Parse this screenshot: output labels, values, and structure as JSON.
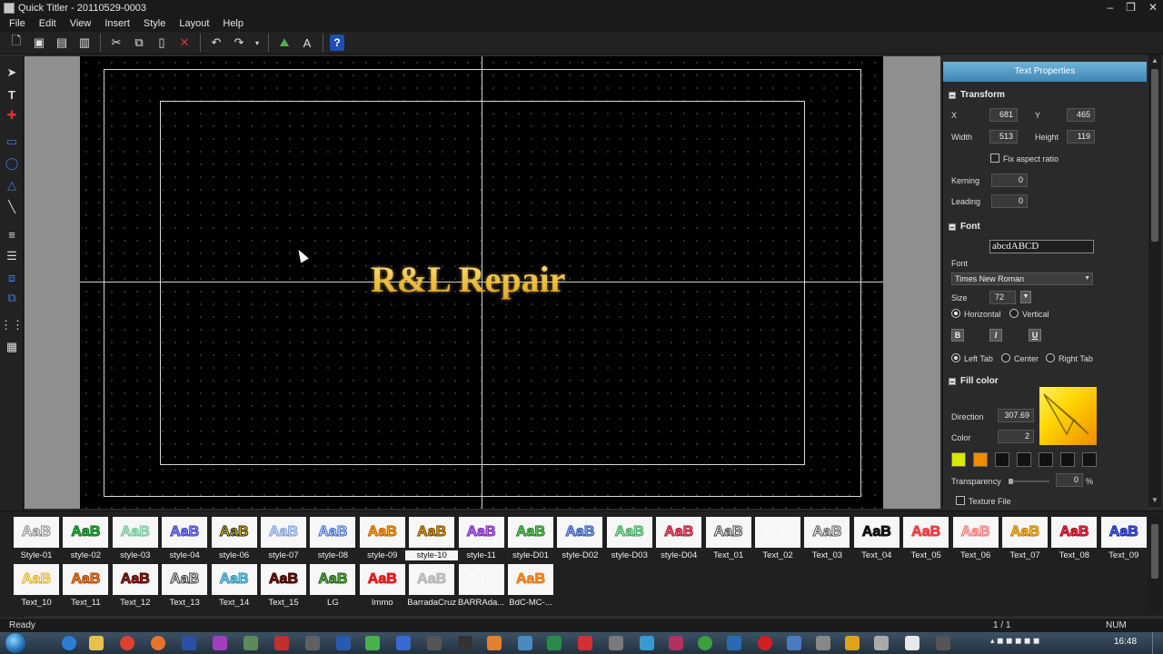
{
  "window": {
    "title": "Quick Titler - 20110529-0003"
  },
  "menu": [
    "File",
    "Edit",
    "View",
    "Insert",
    "Style",
    "Layout",
    "Help"
  ],
  "canvas": {
    "text": "R&L Repair"
  },
  "panel": {
    "header": "Text Properties",
    "transform": {
      "label": "Transform",
      "x_label": "X",
      "x": "681",
      "y_label": "Y",
      "y": "465",
      "width_label": "Width",
      "width": "513",
      "height_label": "Height",
      "height": "119",
      "fix_aspect": "Fix aspect ratio",
      "kerning_label": "Kerning",
      "kerning": "0",
      "leading_label": "Leading",
      "leading": "0"
    },
    "font": {
      "label": "Font",
      "preview": "abcdABCD",
      "font_label": "Font",
      "font_value": "Times New Roman",
      "size_label": "Size",
      "size": "72",
      "horizontal": "Horizontal",
      "vertical": "Vertical",
      "bold": "B",
      "italic": "I",
      "underline": "U",
      "left_tab": "Left Tab",
      "center": "Center",
      "right_tab": "Right Tab"
    },
    "fill": {
      "label": "Fill color",
      "direction_label": "Direction",
      "direction": "307.69",
      "color_label": "Color",
      "color": "2",
      "transparency_label": "Transparency",
      "transparency": "0",
      "percent": "%",
      "texture": "Texture File",
      "swatches": [
        "#d8e800",
        "#f08c00",
        "#111111",
        "#111111",
        "#111111",
        "#111111",
        "#111111"
      ]
    }
  },
  "styles": [
    {
      "name": "Style-01",
      "fg": "#ffffff",
      "bg": "#f7f7f7",
      "stroke": "#888"
    },
    {
      "name": "style-02",
      "fg": "#22c03a",
      "bg": "#f7f7f7",
      "stroke": "#0b6e18"
    },
    {
      "name": "style-03",
      "fg": "#c8f0d8",
      "bg": "#f7f7f7",
      "stroke": "#6cc090"
    },
    {
      "name": "style-04",
      "fg": "#8a8aff",
      "bg": "#f7f7f7",
      "stroke": "#4040c0"
    },
    {
      "name": "style-06",
      "fg": "#f0d000",
      "bg": "#f7f7f7",
      "stroke": "#222"
    },
    {
      "name": "style-07",
      "fg": "#dde8ff",
      "bg": "#f7f7f7",
      "stroke": "#7a9ad8"
    },
    {
      "name": "style-08",
      "fg": "#dfe8ff",
      "bg": "#f7f7f7",
      "stroke": "#3b66c4"
    },
    {
      "name": "style-09",
      "fg": "#f7b300",
      "bg": "#f7f7f7",
      "stroke": "#c05800"
    },
    {
      "name": "style-10",
      "fg": "#e6a400",
      "bg": "#f7f7f7",
      "stroke": "#7a4a00",
      "selected": true
    },
    {
      "name": "style-11",
      "fg": "#c07cf0",
      "bg": "#f7f7f7",
      "stroke": "#7a20b0"
    },
    {
      "name": "style-D01",
      "fg": "#6ad06a",
      "bg": "#f7f7f7",
      "stroke": "#227a22"
    },
    {
      "name": "style-D02",
      "fg": "#9ab6f0",
      "bg": "#f7f7f7",
      "stroke": "#2a52a8"
    },
    {
      "name": "style-D03",
      "fg": "#a8ecb8",
      "bg": "#f7f7f7",
      "stroke": "#3aa058"
    },
    {
      "name": "style-D04",
      "fg": "#f06a80",
      "bg": "#f7f7f7",
      "stroke": "#a81830"
    },
    {
      "name": "Text_01",
      "fg": "#ffffff",
      "bg": "#f7f7f7",
      "stroke": "#444"
    },
    {
      "name": "Text_02",
      "fg": "#ffffff",
      "bg": "#f7f7f7",
      "stroke": "#f7f7f7"
    },
    {
      "name": "Text_03",
      "fg": "#ffffff",
      "bg": "#f7f7f7",
      "stroke": "#555"
    },
    {
      "name": "Text_04",
      "fg": "#111111",
      "bg": "#f7f7f7",
      "stroke": "#111"
    },
    {
      "name": "Text_05",
      "fg": "#f04040",
      "bg": "#f7f7f7",
      "stroke": "#f04040"
    },
    {
      "name": "Text_06",
      "fg": "#ffd0d0",
      "bg": "#f7f7f7",
      "stroke": "#f07070"
    },
    {
      "name": "Text_07",
      "fg": "#ffd030",
      "bg": "#f7f7f7",
      "stroke": "#c07000"
    },
    {
      "name": "Text_08",
      "fg": "#ff3a50",
      "bg": "#f7f7f7",
      "stroke": "#a00018"
    },
    {
      "name": "Text_09",
      "fg": "#5a66ff",
      "bg": "#f7f7f7",
      "stroke": "#1020a0"
    },
    {
      "name": "Text_10",
      "fg": "#f8f0ff",
      "bg": "#f7f7f7",
      "stroke": "#e0b000"
    },
    {
      "name": "Text_11",
      "fg": "#ff8a2a",
      "bg": "#f7f7f7",
      "stroke": "#a04000"
    },
    {
      "name": "Text_12",
      "fg": "#b02020",
      "bg": "#f7f7f7",
      "stroke": "#400000"
    },
    {
      "name": "Text_13",
      "fg": "#ffffff",
      "bg": "#f7f7f7",
      "stroke": "#333"
    },
    {
      "name": "Text_14",
      "fg": "#8ad8f0",
      "bg": "#f7f7f7",
      "stroke": "#2a8ab0"
    },
    {
      "name": "Text_15",
      "fg": "#801010",
      "bg": "#f7f7f7",
      "stroke": "#300000"
    },
    {
      "name": "LG",
      "fg": "#6ab84a",
      "bg": "#f7f7f7",
      "stroke": "#1a5a10"
    },
    {
      "name": "Immo",
      "fg": "#e02020",
      "bg": "#f7f7f7",
      "stroke": "#e02020"
    },
    {
      "name": "BarradaCruz",
      "fg": "#bbbbbb",
      "bg": "#f7f7f7",
      "stroke": "#bbbbbb"
    },
    {
      "name": "BARRAda...",
      "fg": "#ffffff",
      "bg": "#f7f7f7",
      "stroke": "#f7f7f7"
    },
    {
      "name": "BdC-MC-...",
      "fg": "#f08020",
      "bg": "#f7f7f7",
      "stroke": "#f08020"
    }
  ],
  "style_sample": "AaB",
  "status": {
    "ready": "Ready",
    "pages": "1 / 1",
    "num": "NUM"
  },
  "taskbar": {
    "clock": "16:48"
  }
}
